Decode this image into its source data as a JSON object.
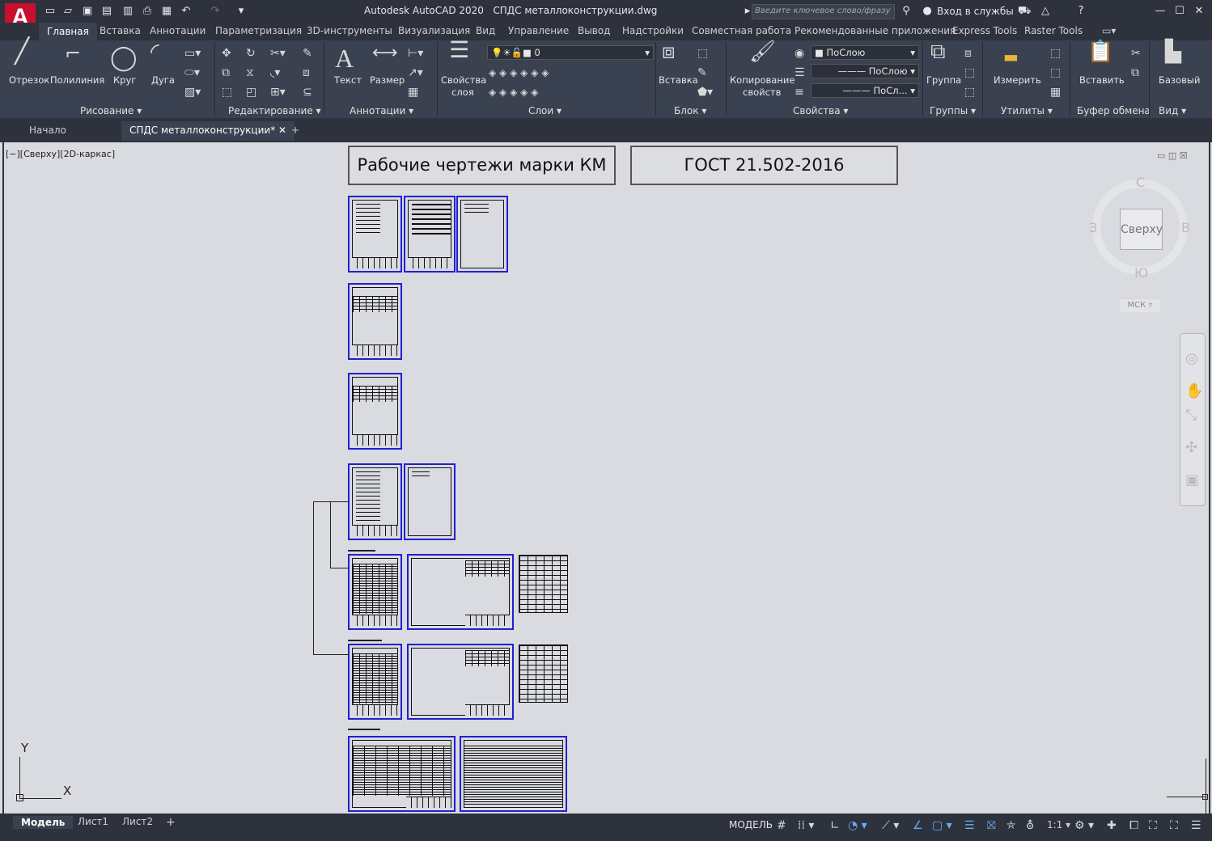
{
  "app": {
    "logo": "A",
    "title": "Autodesk AutoCAD 2020",
    "file": "СПДС металлоконструкции.dwg",
    "search_placeholder": "Введите ключевое слово/фразу",
    "signin": "Вход в службы"
  },
  "menu": {
    "tabs": [
      "Главная",
      "Вставка",
      "Аннотации",
      "Параметризация",
      "3D-инструменты",
      "Визуализация",
      "Вид",
      "Управление",
      "Вывод",
      "Надстройки",
      "Совместная работа",
      "Рекомендованные приложения",
      "Express Tools",
      "Raster Tools"
    ]
  },
  "ribbon": {
    "draw": {
      "line": "Отрезок",
      "polyline": "Полилиния",
      "circle": "Круг",
      "arc": "Дуга",
      "panel": "Рисование"
    },
    "modify": {
      "panel": "Редактирование"
    },
    "annot": {
      "text": "Текст",
      "dim": "Размер",
      "panel": "Аннотации"
    },
    "layers": {
      "props": "Свойства слоя",
      "props2": "слоя",
      "props1": "Свойства",
      "current": "0",
      "panel": "Слои"
    },
    "block": {
      "insert": "Вставка",
      "panel": "Блок"
    },
    "props": {
      "copy1": "Копирование",
      "copy2": "свойств",
      "color": "ПоСлою",
      "ltype": "ПоСлою",
      "lweight": "ПоСл...",
      "panel": "Свойства"
    },
    "groups": {
      "group": "Группа",
      "panel": "Группы"
    },
    "utils": {
      "measure": "Измерить",
      "panel": "Утилиты"
    },
    "clip": {
      "paste": "Вставить",
      "panel": "Буфер обмена"
    },
    "view": {
      "base": "Базовый",
      "panel": "Вид"
    }
  },
  "doctabs": {
    "start": "Начало",
    "file": "СПДС металлоконструкции*"
  },
  "viewport": {
    "label": "[−][Сверху][2D-каркас]",
    "title1": "Рабочие чертежи марки КМ",
    "title2": "ГОСТ 21.502-2016",
    "cube_face": "Сверху",
    "north": "С",
    "south": "Ю",
    "west": "З",
    "east": "В",
    "wcs": "МСК",
    "axis_y": "Y",
    "axis_x": "X"
  },
  "status": {
    "model": "Модель",
    "sheet1": "Лист1",
    "sheet2": "Лист2",
    "mode": "МОДЕЛЬ",
    "scale": "1:1"
  }
}
